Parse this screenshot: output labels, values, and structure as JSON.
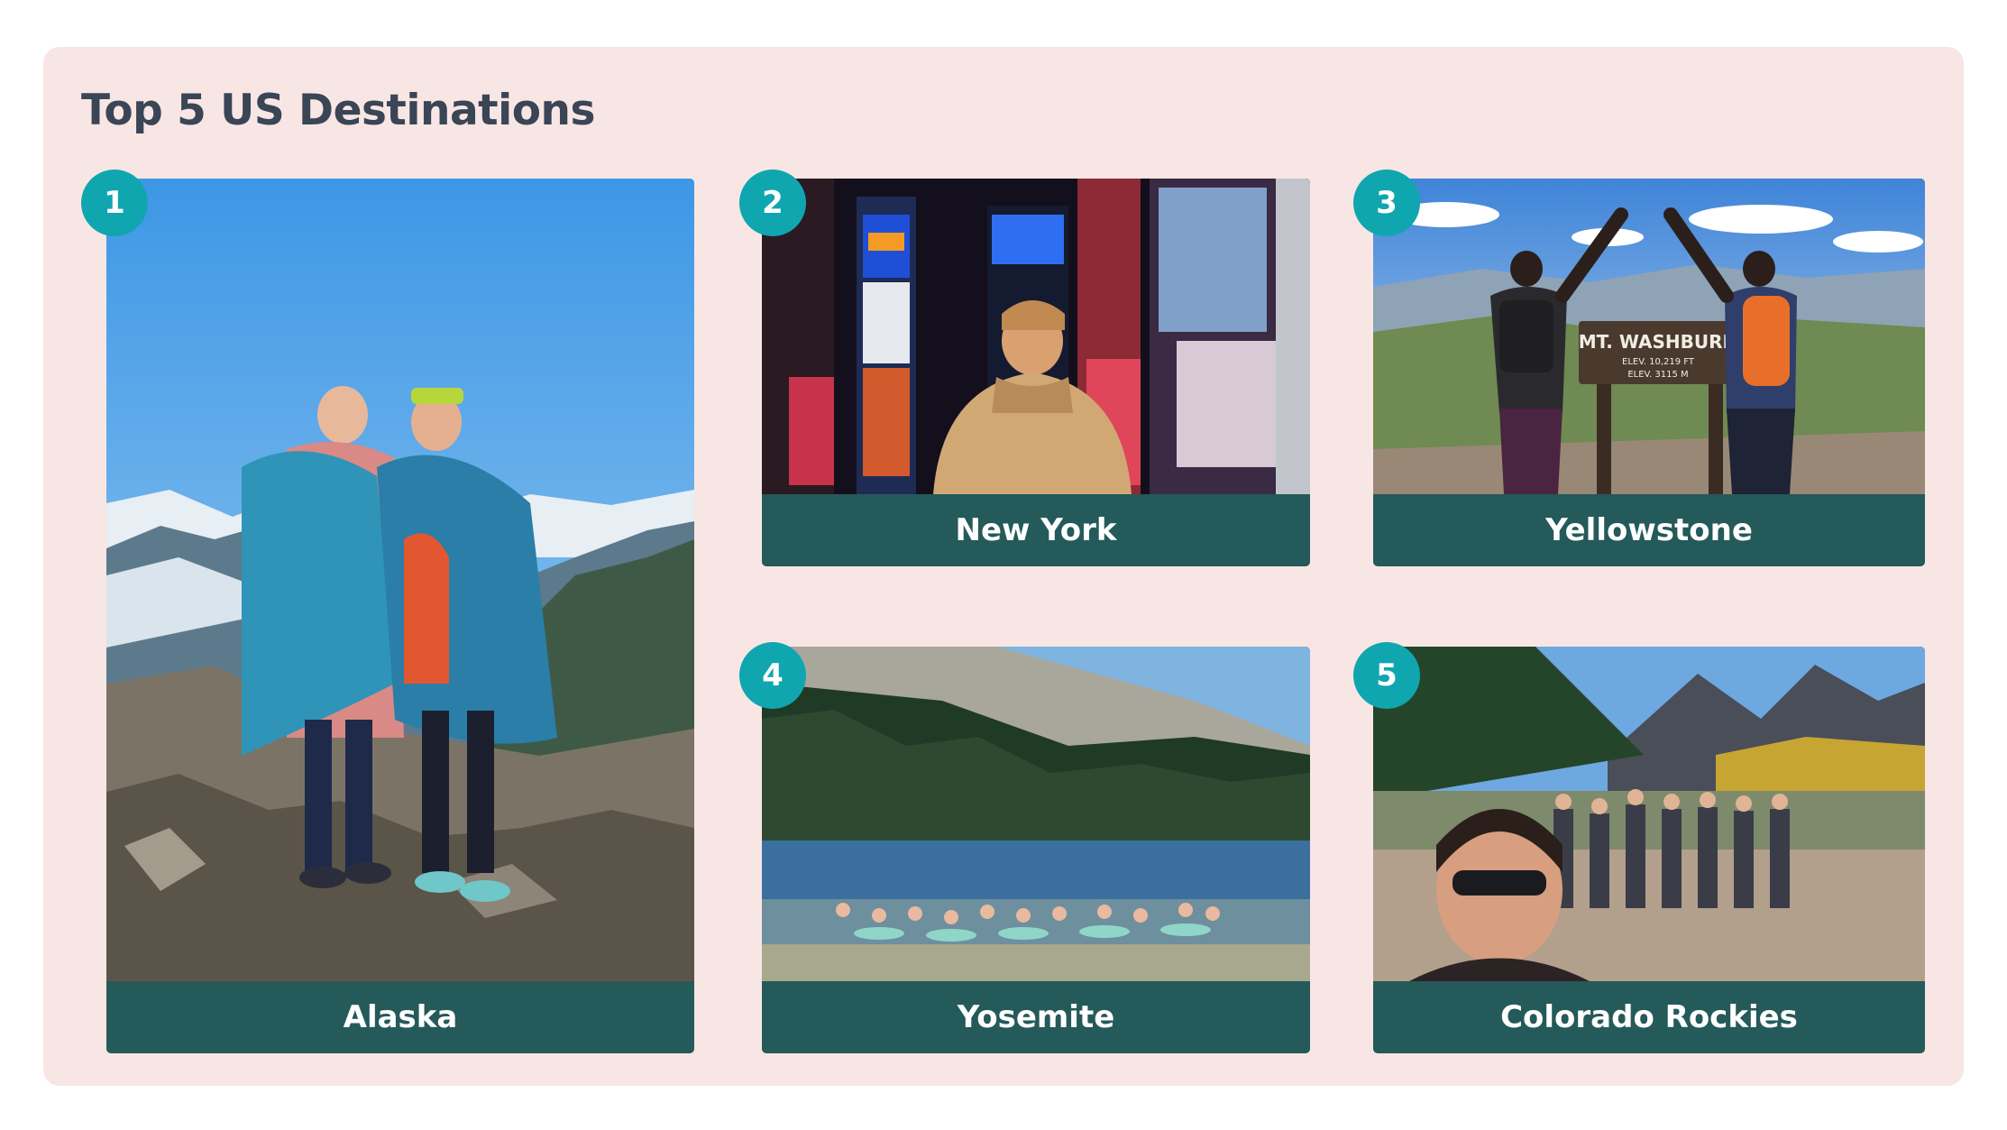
{
  "slide": {
    "title": "Top 5 US Destinations"
  },
  "destinations": [
    {
      "rank": "1",
      "name": "Alaska",
      "photo": "two hikers wrapped in blankets on a rocky mountain summit"
    },
    {
      "rank": "2",
      "name": "New York",
      "photo": "person in hoodie looking at Times Square billboards at night"
    },
    {
      "rank": "3",
      "name": "Yellowstone",
      "photo": "two hikers with raised arms beside Mt. Washburn summit sign"
    },
    {
      "rank": "4",
      "name": "Yosemite",
      "photo": "group floating in an alpine lake below forested granite slope"
    },
    {
      "rank": "5",
      "name": "Colorado Rockies",
      "photo": "group selfie at lake with aspens and jagged peaks"
    }
  ],
  "photo_signs": {
    "yellowstone_sign_line1": "MT. WASHBURN",
    "yellowstone_sign_line2": "ELEV. 10,219 FT",
    "yellowstone_sign_line3": "ELEV. 3115 M"
  },
  "colors": {
    "panel_bg": "#f8e6e4",
    "title": "#3a4556",
    "caption_bar": "#245a59",
    "badge": "#0fa6b0",
    "caption_text": "#ffffff"
  }
}
